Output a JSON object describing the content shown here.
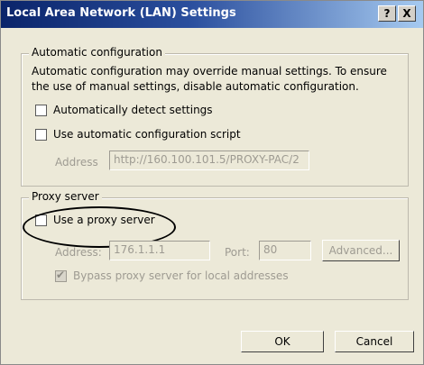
{
  "window": {
    "title": "Local Area Network (LAN) Settings",
    "help_label": "?",
    "close_label": "X"
  },
  "auto_config": {
    "legend": "Automatic configuration",
    "description": "Automatic configuration may override manual settings.  To ensure the use of manual settings, disable automatic configuration.",
    "detect_label": "Automatically detect settings",
    "detect_checked": false,
    "script_label": "Use automatic configuration script",
    "script_checked": false,
    "address_label": "Address",
    "address_value": "http://160.100.101.5/PROXY-PAC/2"
  },
  "proxy": {
    "legend": "Proxy server",
    "use_proxy_label": "Use a proxy server",
    "use_proxy_checked": false,
    "address_label": "Address:",
    "address_value": "176.1.1.1",
    "port_label": "Port:",
    "port_value": "80",
    "advanced_label": "Advanced...",
    "bypass_label": "Bypass proxy server for local addresses",
    "bypass_checked": true
  },
  "buttons": {
    "ok": "OK",
    "cancel": "Cancel"
  }
}
